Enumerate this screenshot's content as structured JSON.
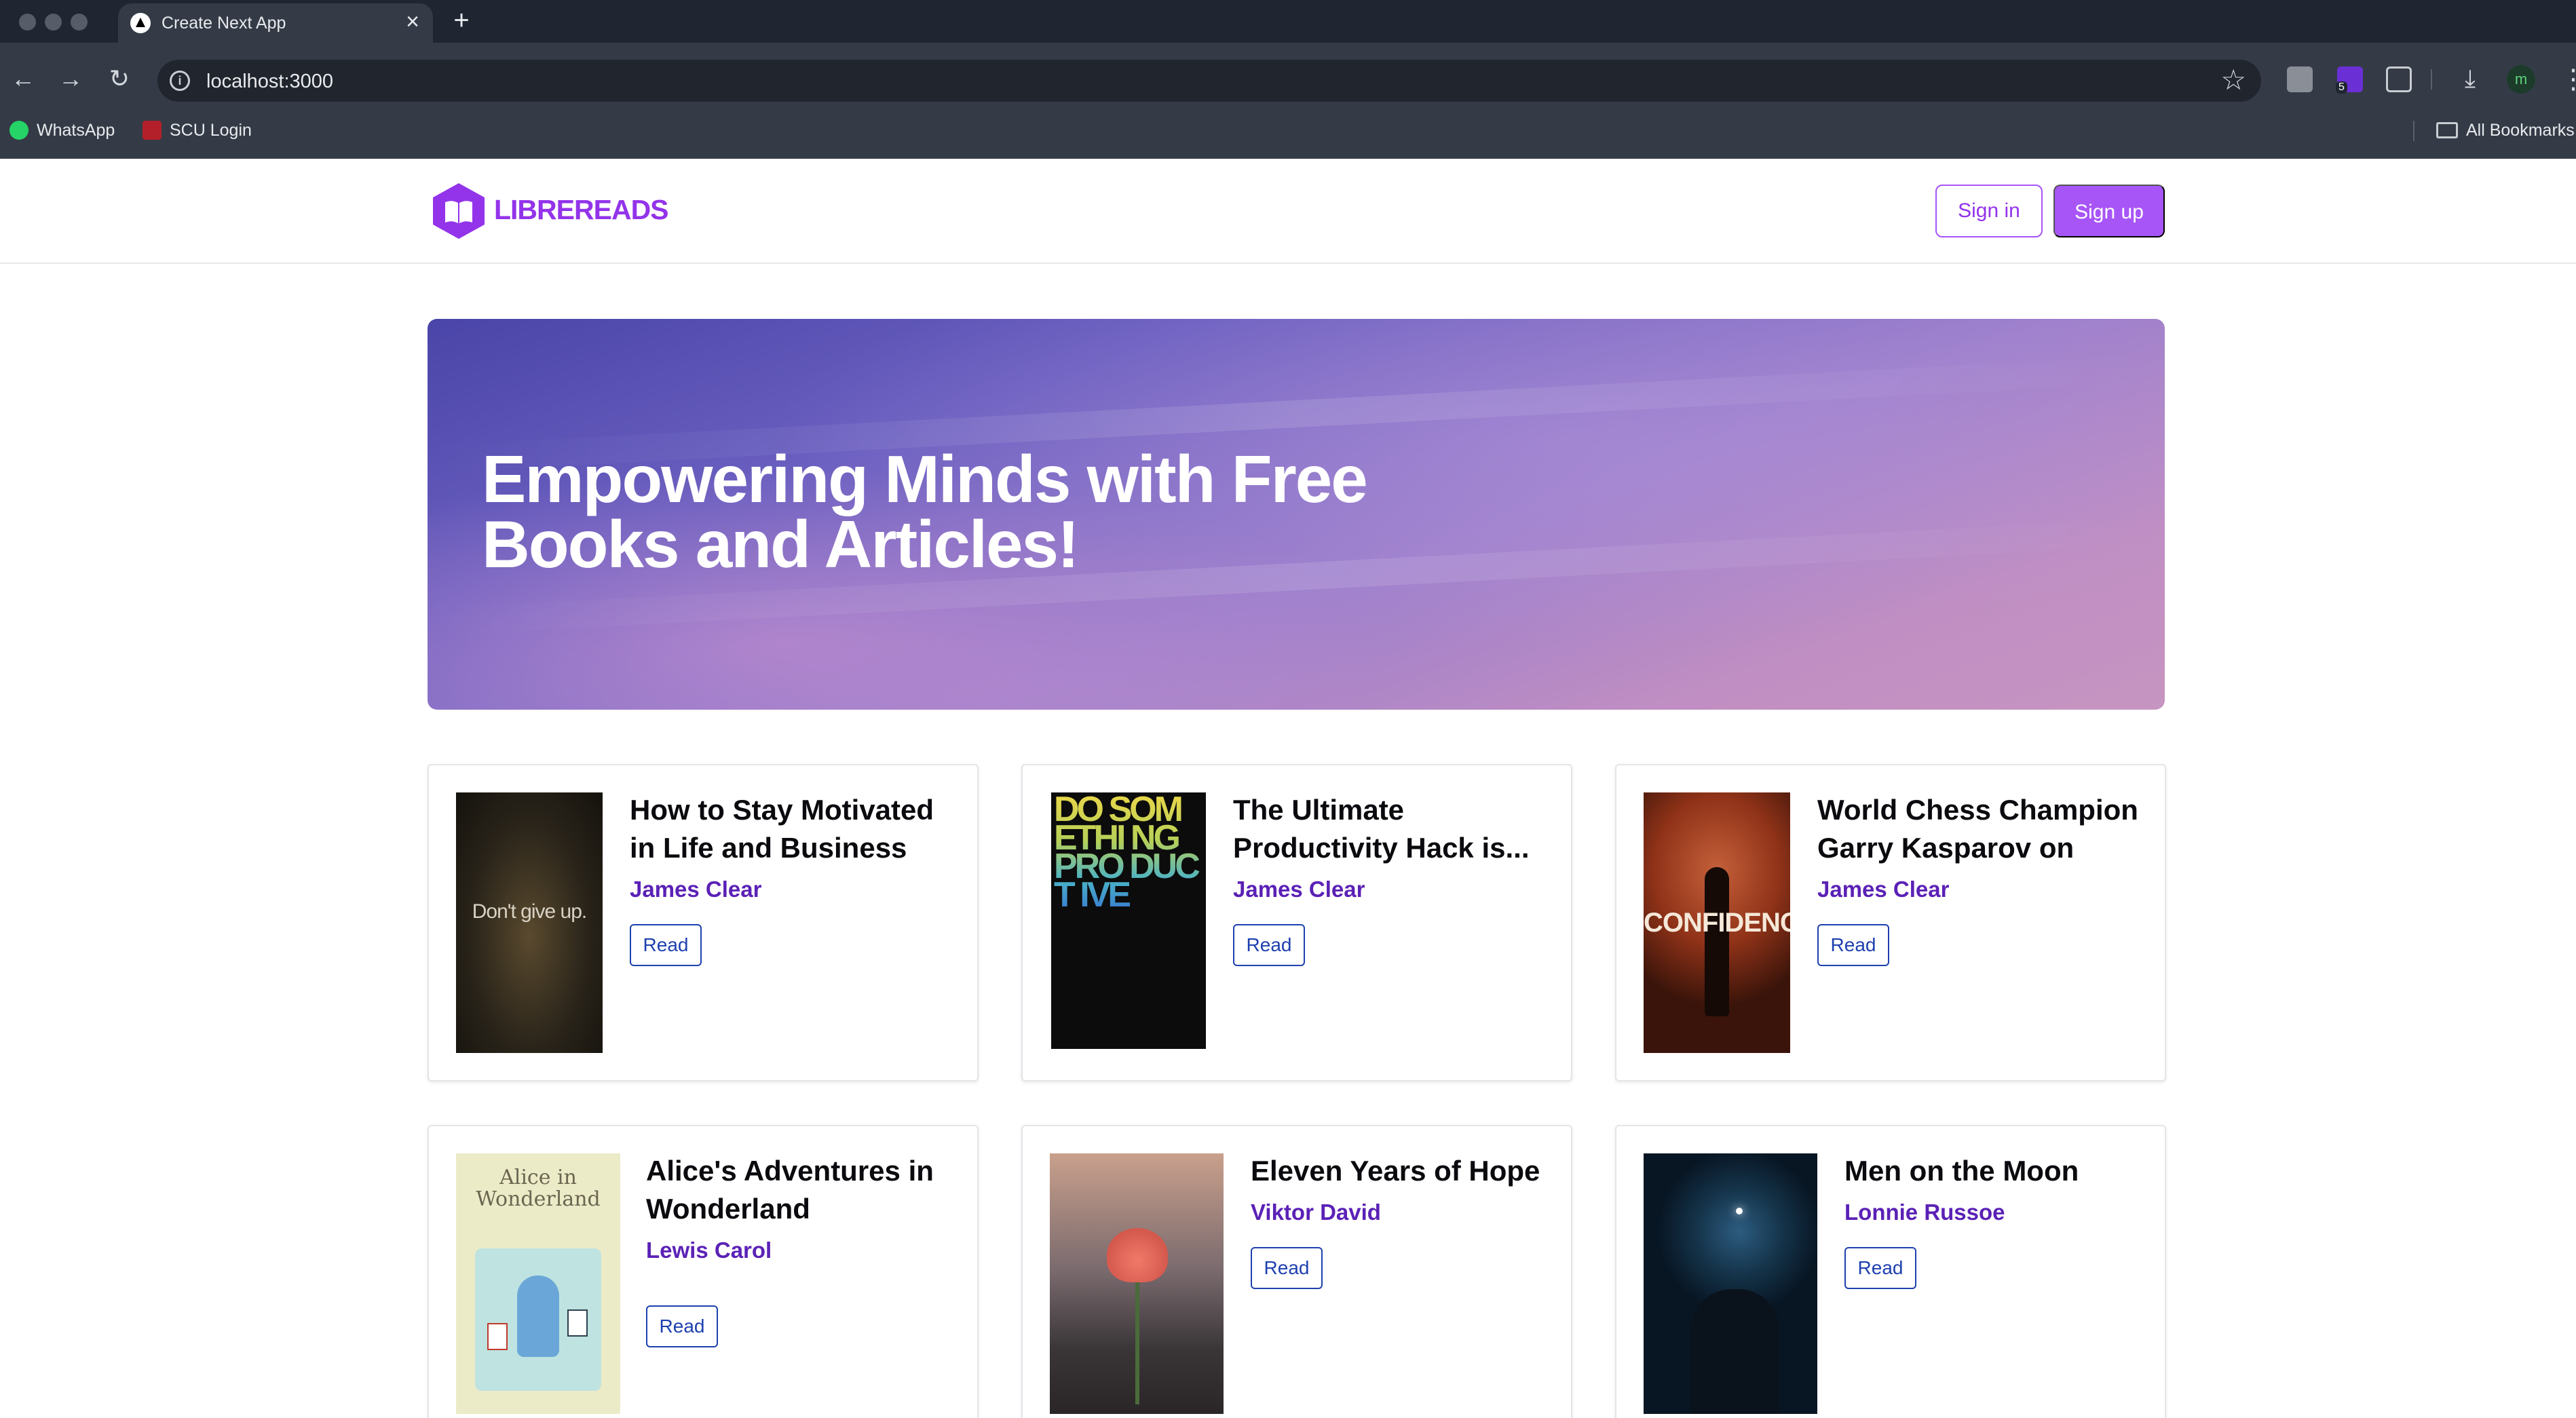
{
  "browser": {
    "tab_title": "Create Next App",
    "url": "localhost:3000",
    "extension_badge": "5",
    "profile_initial": "m",
    "bookmarks": [
      {
        "label": "WhatsApp",
        "icon": "whatsapp-icon"
      },
      {
        "label": "SCU Login",
        "icon": "scu-icon"
      }
    ],
    "all_bookmarks_label": "All Bookmarks"
  },
  "header": {
    "brand": "LIBREREADS",
    "signin_label": "Sign in",
    "signup_label": "Sign up"
  },
  "hero": {
    "title": "Empowering Minds with Free Books and Articles!"
  },
  "books": [
    {
      "title": "How to Stay Motivated in Life and Business",
      "author": "James Clear",
      "read_label": "Read",
      "cover": "dont-give-up-cover",
      "cover_text": "Don't give up."
    },
    {
      "title": "The Ultimate Productivity Hack is...",
      "author": "James Clear",
      "read_label": "Read",
      "cover": "do-something-productive-cover",
      "cover_text": "DO SOM ETHI NG PRO DUCT IVE"
    },
    {
      "title": "World Chess Champion Garry Kasparov on Ho...",
      "author": "James Clear",
      "read_label": "Read",
      "cover": "confidence-cover",
      "cover_text": "CONFIDENCE"
    },
    {
      "title": "Alice's Adventures in Wonderland",
      "author": "Lewis Carol",
      "read_label": "Read",
      "cover": "alice-cover",
      "cover_text": "Alice in Wonderland"
    },
    {
      "title": "Eleven Years of Hope",
      "author": "Viktor David",
      "read_label": "Read",
      "cover": "flower-cover",
      "cover_text": ""
    },
    {
      "title": "Men on the Moon",
      "author": "Lonnie Russoe",
      "read_label": "Read",
      "cover": "moon-cover",
      "cover_text": ""
    }
  ],
  "colors": {
    "brand": "#9333ea",
    "signup_bg": "#a855f7",
    "author": "#5b21b6",
    "read_button": "#1e40af"
  }
}
